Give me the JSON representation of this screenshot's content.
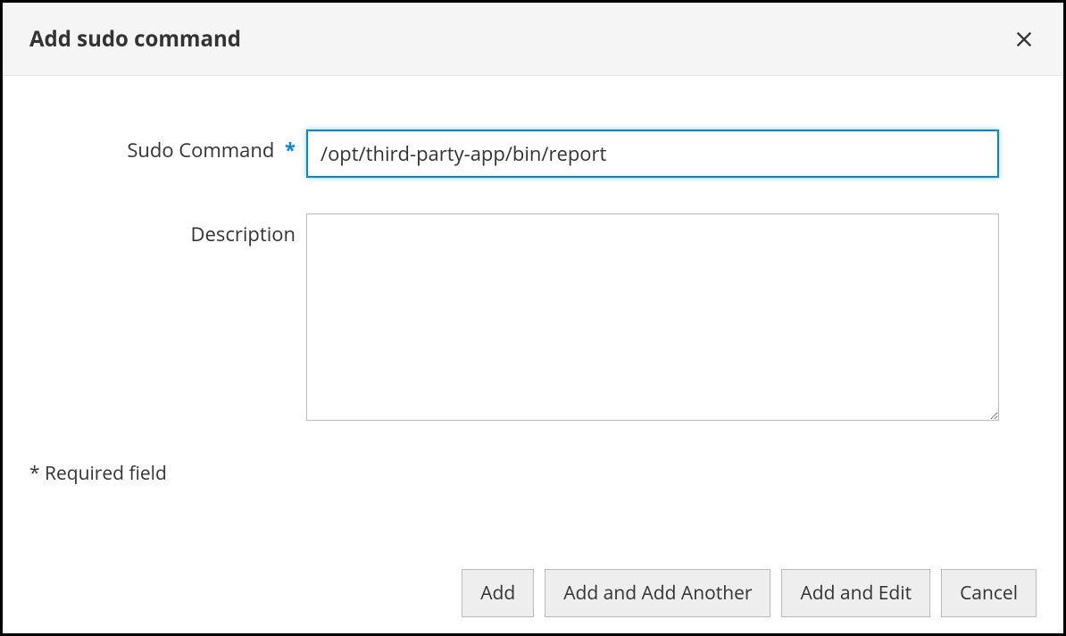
{
  "modal": {
    "title": "Add sudo command"
  },
  "form": {
    "sudo_command_label": "Sudo Command",
    "sudo_command_value": "/opt/third-party-app/bin/report",
    "description_label": "Description",
    "description_value": "",
    "required_note": "* Required field"
  },
  "buttons": {
    "add": "Add",
    "add_another": "Add and Add Another",
    "add_edit": "Add and Edit",
    "cancel": "Cancel"
  }
}
